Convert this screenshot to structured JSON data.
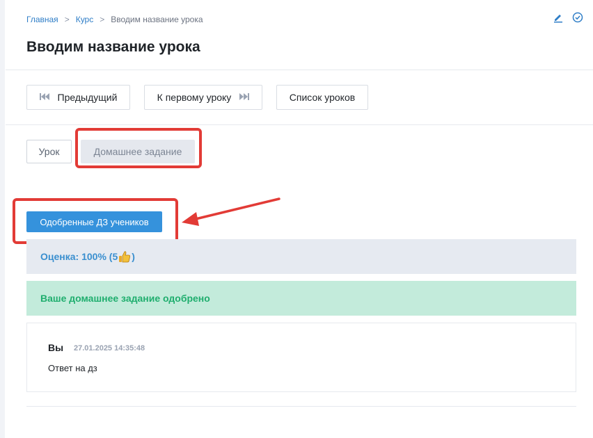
{
  "breadcrumb": {
    "items": [
      "Главная",
      "Курс",
      "Вводим название урока"
    ],
    "separator": ">"
  },
  "top_icons": [
    "pencil-icon",
    "check-circle-icon"
  ],
  "page_title": "Вводим название урока",
  "nav": {
    "prev_label": "Предыдущий",
    "first_label": "К первому уроку",
    "list_label": "Список уроков"
  },
  "tabs": {
    "lesson_label": "Урок",
    "homework_label": "Домашнее задание"
  },
  "approved_button_label": "Одобренные ДЗ учеников",
  "grade": {
    "label": "Оценка: 100% (5 ",
    "suffix": ")",
    "icon": "thumbs-up-icon"
  },
  "status_message": "Ваше домашнее задание одобрено",
  "answer": {
    "author": "Вы",
    "timestamp": "27.01.2025 14:35:48",
    "text": "Ответ на дз"
  },
  "colors": {
    "accent": "#3592dc",
    "link": "#2f7ec7",
    "success_bg": "#c3ebdb",
    "success_text": "#1fae6e",
    "annotation": "#e23b36"
  }
}
